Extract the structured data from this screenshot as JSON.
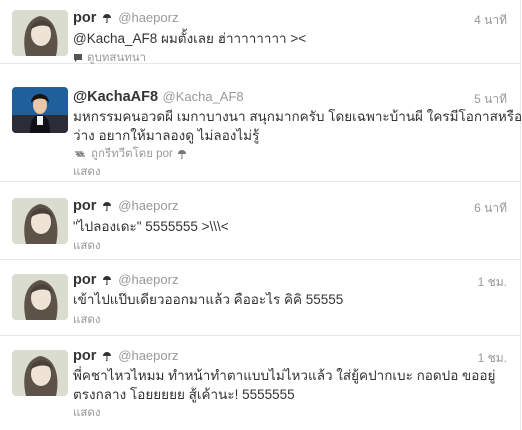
{
  "tweets": [
    {
      "name": "por",
      "handle": "@haeporz",
      "time": "4 นาที",
      "text_lines": [
        "@Kacha_AF8 ผมตั้งเลย ฮ่าาาาาาาา ><"
      ],
      "action": "ดูบทสนทนา",
      "action_icon": "conversation-icon"
    },
    {
      "name": "@KachaAF8",
      "handle": "@Kacha_AF8",
      "time": "5 นาที",
      "text_lines": [
        "มหกรรมคนอวดผี เมกาบางนา สนุกมากครับ โดยเฉพาะบ้านผี ใครมีโอกาสหรือ",
        "ว่าง อยากให้มาลองดู ไม่ลองไม่รู้"
      ],
      "retweet_note": "ถูกรีทวีตโดย por",
      "action": "แสดง",
      "action_icon": "retweet-icon"
    },
    {
      "name": "por",
      "handle": "@haeporz",
      "time": "6 นาที",
      "text_lines": [
        "\"ไปลองเดะ\" 5555555 >\\\\\\<"
      ],
      "action": "แสดง"
    },
    {
      "name": "por",
      "handle": "@haeporz",
      "time": "1 ชม.",
      "text_lines": [
        "เข้าไปแป๊บเดียวออกมาแล้ว คืออะไร คิคิ 55555"
      ],
      "action": "แสดง"
    },
    {
      "name": "por",
      "handle": "@haeporz",
      "time": "1 ชม.",
      "text_lines": [
        "พี่คชาไหวไหมม ทำหน้าทำตาแบบไม่ไหวแล้ว ใส่ยู้คปากเบะ กอดปอ ขออยู่",
        "ตรงกลาง โอยยยยย สู้เค้านะ! 5555555"
      ],
      "action": "แสดง"
    }
  ],
  "colors": {
    "link": "#999999",
    "name": "#333333",
    "divider": "#e8e8e8"
  },
  "icons": {
    "umbrella": "umbrella-icon",
    "avatar_por": "avatar-photo",
    "avatar_kacha": "avatar-photo"
  }
}
